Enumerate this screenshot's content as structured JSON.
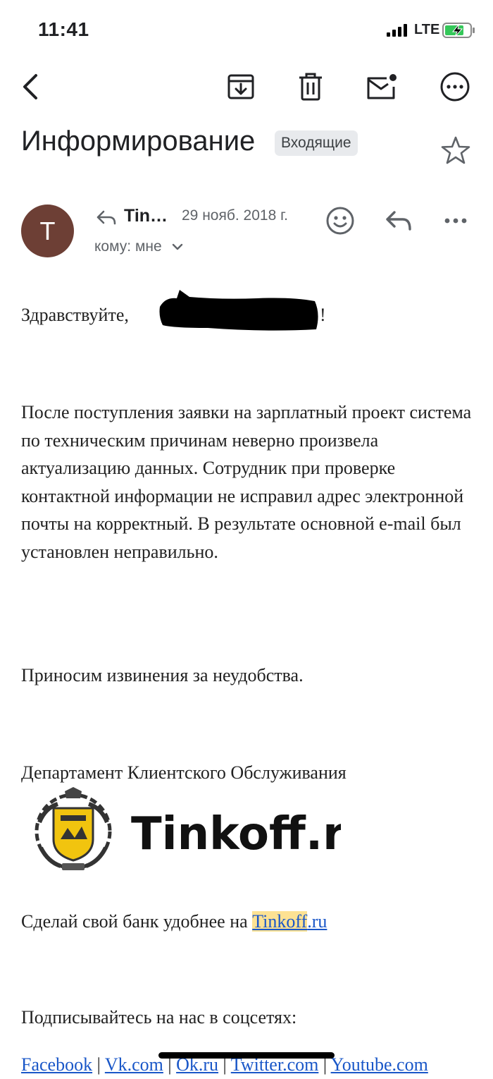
{
  "status": {
    "time": "11:41",
    "network": "LTE"
  },
  "toolbar": {
    "icons": [
      "back-arrow-icon",
      "archive-icon",
      "trash-icon",
      "mark-unread-icon",
      "more-horizontal-icon"
    ]
  },
  "email": {
    "subject": "Информирование",
    "label": "Входящие",
    "sender_initial": "T",
    "sender_name": "Tin…",
    "date": "29 нояб. 2018 г.",
    "to": "кому: мне",
    "greeting": "Здравствуйте, ",
    "greeting_end": "!",
    "body": "После поступления заявки на зарплатный проект система по техническим причинам неверно произвела актуализацию данных. Сотрудник при проверке контактной информации не исправил адрес электронной почты на корректный. В результате основной e-mail был установлен неправильно.",
    "apology": "Приносим извинения за неудобства.",
    "department": "Департамент Клиентского Обслуживания",
    "logo_text": "Tinkoff.ru",
    "cta_prefix": "Сделай свой банк удобнее на ",
    "cta_link_highlight": "Tinkoff",
    "cta_link_rest": ".ru",
    "subscribe": "Подписывайтесь на нас в соцсетях:",
    "social": [
      "Facebook",
      "Vk.com",
      "Ok.ru",
      "Twitter.com",
      "Youtube.com"
    ],
    "social_separator": "|"
  },
  "colors": {
    "avatar": "#6d3f35",
    "link": "#1a57c8",
    "highlight": "#fde293",
    "chip": "#e8eaed"
  }
}
